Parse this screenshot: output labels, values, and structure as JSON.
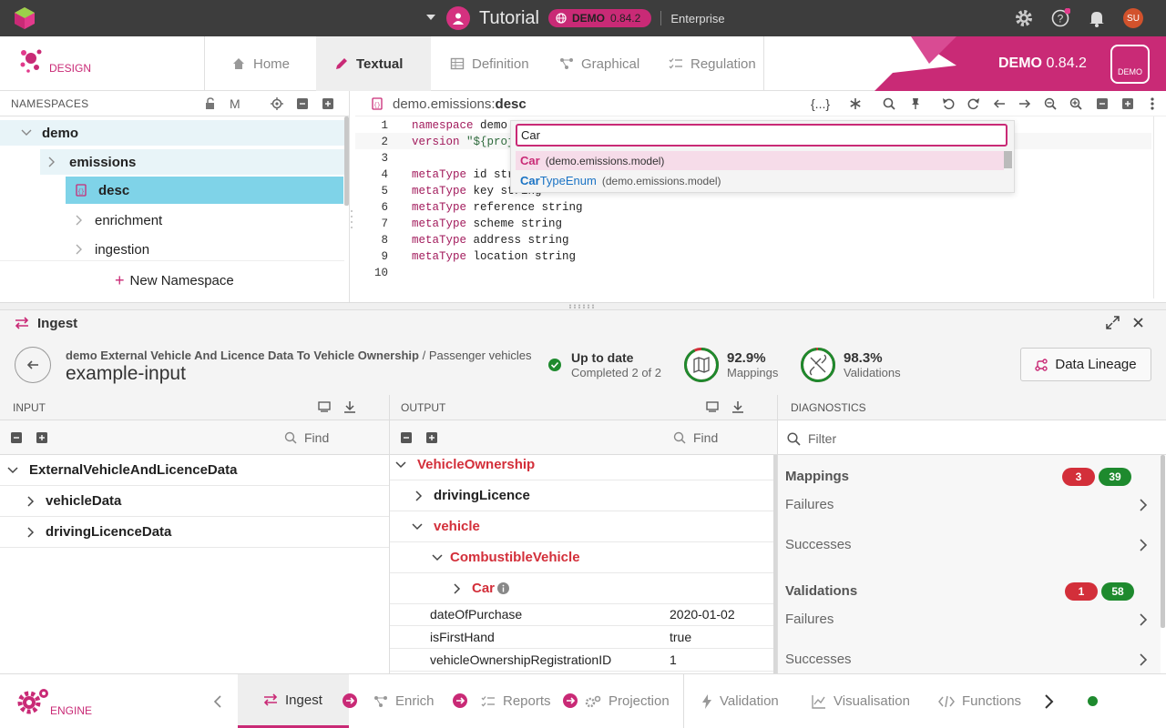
{
  "topbar": {
    "project_title": "Tutorial",
    "env_badge": "DEMO",
    "env_version": "0.84.2",
    "edition": "Enterprise",
    "user_initials": "SU",
    "accent": "#c92a76"
  },
  "design": {
    "label": "DESIGN",
    "tabs": [
      {
        "label": "Home",
        "icon": "home-icon"
      },
      {
        "label": "Textual",
        "icon": "pencil-icon"
      },
      {
        "label": "Definition",
        "icon": "table-icon"
      },
      {
        "label": "Graphical",
        "icon": "graph-icon"
      },
      {
        "label": "Regulation",
        "icon": "checklist-icon"
      }
    ],
    "active_tab": "Textual",
    "banner_env": "DEMO",
    "banner_version": "0.84.2",
    "badge": "DEMO"
  },
  "namespaces": {
    "header": "NAMESPACES",
    "m_label": "M",
    "tree": [
      {
        "label": "demo"
      },
      {
        "label": "emissions"
      },
      {
        "label": "desc"
      },
      {
        "label": "enrichment"
      },
      {
        "label": "ingestion"
      }
    ],
    "new_button": "New Namespace"
  },
  "editor": {
    "path_prefix": "demo.emissions:",
    "path_name": "desc",
    "brace_label": "{...}",
    "lines": [
      {
        "n": "1",
        "kw": "namespace",
        "rest": " demo."
      },
      {
        "n": "2",
        "kw": "version",
        "rest": " ",
        "str": "\"${proj"
      },
      {
        "n": "3",
        "kw": "",
        "rest": ""
      },
      {
        "n": "4",
        "kw": "metaType",
        "rest": " id str"
      },
      {
        "n": "5",
        "kw": "metaType",
        "rest": " key string"
      },
      {
        "n": "6",
        "kw": "metaType",
        "rest": " reference string"
      },
      {
        "n": "7",
        "kw": "metaType",
        "rest": " scheme string"
      },
      {
        "n": "8",
        "kw": "metaType",
        "rest": " address string"
      },
      {
        "n": "9",
        "kw": "metaType",
        "rest": " location string"
      },
      {
        "n": "10",
        "kw": "",
        "rest": ""
      }
    ],
    "autocomplete": {
      "query": "Car",
      "items": [
        {
          "match": "Car",
          "rest": "",
          "ns": "(demo.emissions.model)"
        },
        {
          "match": "Car",
          "rest": "TypeEnum",
          "ns": "(demo.emissions.model)"
        }
      ]
    }
  },
  "ingest": {
    "title": "Ingest",
    "breadcrumb_main": "demo External Vehicle And Licence Data To Vehicle Ownership",
    "breadcrumb_sep": " / ",
    "breadcrumb_sub": "Passenger vehicles",
    "name": "example-input",
    "status_title": "Up to date",
    "status_sub": "Completed 2 of 2",
    "mappings_pct": "92.9%",
    "mappings_label": "Mappings",
    "mappings_value": 0.929,
    "validations_pct": "98.3%",
    "validations_label": "Validations",
    "validations_value": 0.983,
    "lineage_button": "Data Lineage"
  },
  "input": {
    "header": "INPUT",
    "find": "Find",
    "rows": [
      {
        "label": "ExternalVehicleAndLicenceData"
      },
      {
        "label": "vehicleData"
      },
      {
        "label": "drivingLicenceData"
      }
    ]
  },
  "output": {
    "header": "OUTPUT",
    "find": "Find",
    "rows": [
      {
        "label": "VehicleOwnership"
      },
      {
        "label": "drivingLicence"
      },
      {
        "label": "vehicle"
      },
      {
        "label": "CombustibleVehicle"
      },
      {
        "label": "Car"
      }
    ],
    "values": [
      {
        "k": "dateOfPurchase",
        "v": "2020-01-02"
      },
      {
        "k": "isFirstHand",
        "v": "true"
      },
      {
        "k": "vehicleOwnershipRegistrationID",
        "v": "1"
      }
    ]
  },
  "diagnostics": {
    "header": "DIAGNOSTICS",
    "filter": "Filter",
    "mappings": {
      "title": "Mappings",
      "fail_count": "3",
      "ok_count": "39"
    },
    "validations": {
      "title": "Validations",
      "fail_count": "1",
      "ok_count": "58"
    },
    "failures": "Failures",
    "successes": "Successes",
    "red": "#d32f3a",
    "green": "#1e8a2e"
  },
  "bottom": {
    "label": "ENGINE",
    "tabs": [
      {
        "label": "Ingest",
        "icon": "swap-icon"
      },
      {
        "label": "Enrich",
        "icon": "graph-icon"
      },
      {
        "label": "Reports",
        "icon": "checklist-icon"
      },
      {
        "label": "Projection",
        "icon": "gears-icon"
      },
      {
        "label": "Validation",
        "icon": "bolt-icon"
      },
      {
        "label": "Visualisation",
        "icon": "chart-icon"
      },
      {
        "label": "Functions",
        "icon": "code-icon"
      }
    ]
  }
}
